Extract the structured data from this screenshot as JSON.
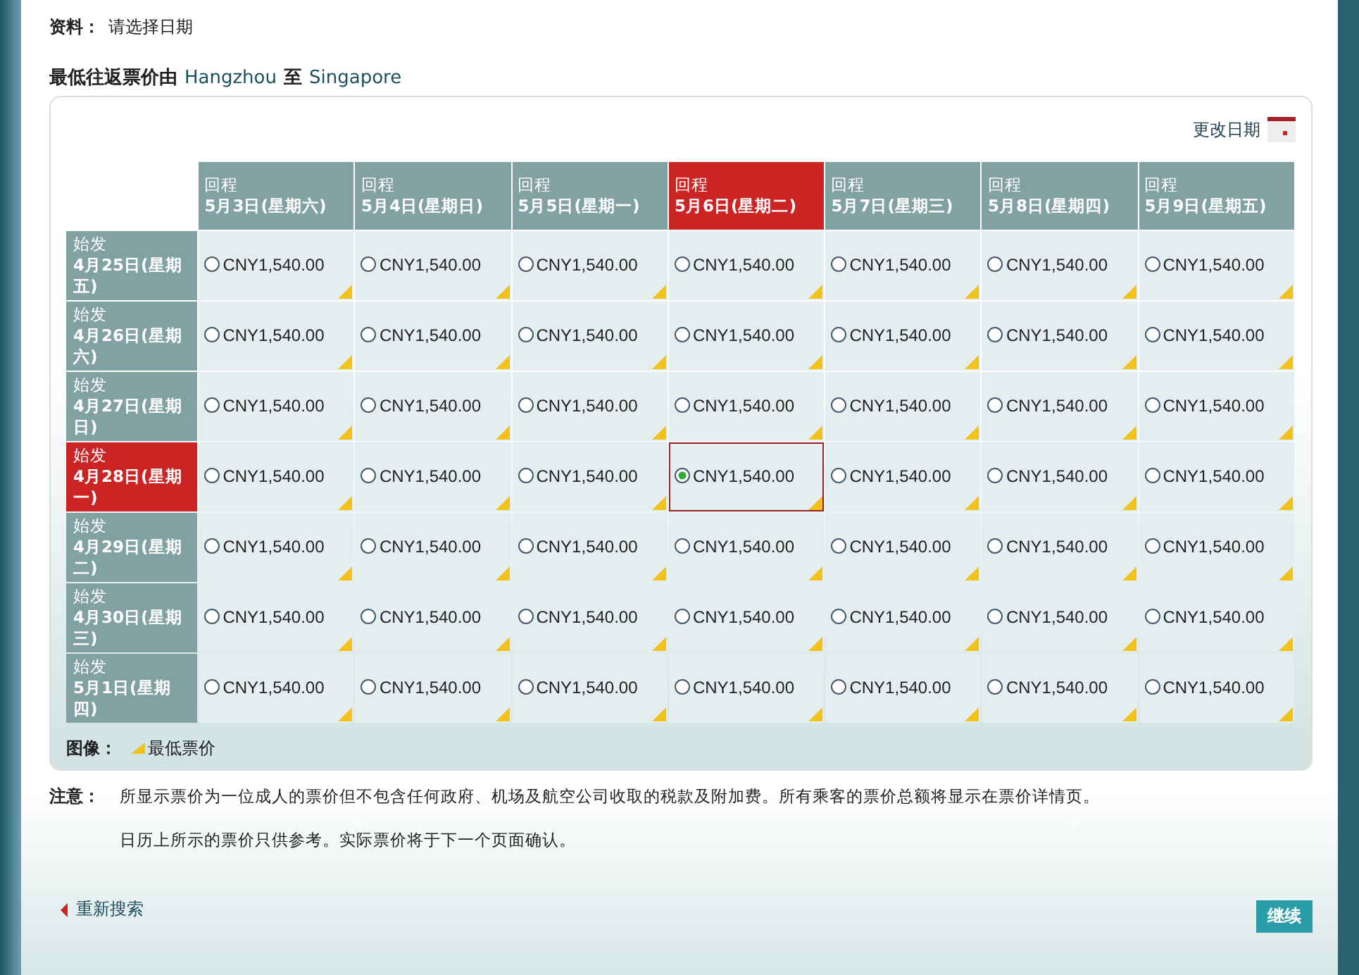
{
  "info": {
    "label": "资料：",
    "text": "请选择日期"
  },
  "heading": {
    "text": "最低往返票价由",
    "origin": "Hangzhou",
    "joiner": "至",
    "destination": "Singapore"
  },
  "change_date": {
    "label": "更改日期"
  },
  "columns": [
    {
      "kind_label": "回程",
      "date": "5月3日(星期六)",
      "selected": false
    },
    {
      "kind_label": "回程",
      "date": "5月4日(星期日)",
      "selected": false
    },
    {
      "kind_label": "回程",
      "date": "5月5日(星期一)",
      "selected": false
    },
    {
      "kind_label": "回程",
      "date": "5月6日(星期二)",
      "selected": true
    },
    {
      "kind_label": "回程",
      "date": "5月7日(星期三)",
      "selected": false
    },
    {
      "kind_label": "回程",
      "date": "5月8日(星期四)",
      "selected": false
    },
    {
      "kind_label": "回程",
      "date": "5月9日(星期五)",
      "selected": false
    }
  ],
  "rows": [
    {
      "kind_label": "始发",
      "date": "4月25日(星期五)",
      "selected": false,
      "cells": [
        {
          "price": "CNY1,540.00",
          "selected": false,
          "lowest": true
        },
        {
          "price": "CNY1,540.00",
          "selected": false,
          "lowest": true
        },
        {
          "price": "CNY1,540.00",
          "selected": false,
          "lowest": true
        },
        {
          "price": "CNY1,540.00",
          "selected": false,
          "lowest": true
        },
        {
          "price": "CNY1,540.00",
          "selected": false,
          "lowest": true
        },
        {
          "price": "CNY1,540.00",
          "selected": false,
          "lowest": true
        },
        {
          "price": "CNY1,540.00",
          "selected": false,
          "lowest": true
        }
      ]
    },
    {
      "kind_label": "始发",
      "date": "4月26日(星期六)",
      "selected": false,
      "cells": [
        {
          "price": "CNY1,540.00",
          "selected": false,
          "lowest": true
        },
        {
          "price": "CNY1,540.00",
          "selected": false,
          "lowest": true
        },
        {
          "price": "CNY1,540.00",
          "selected": false,
          "lowest": true
        },
        {
          "price": "CNY1,540.00",
          "selected": false,
          "lowest": true
        },
        {
          "price": "CNY1,540.00",
          "selected": false,
          "lowest": true
        },
        {
          "price": "CNY1,540.00",
          "selected": false,
          "lowest": true
        },
        {
          "price": "CNY1,540.00",
          "selected": false,
          "lowest": true
        }
      ]
    },
    {
      "kind_label": "始发",
      "date": "4月27日(星期日)",
      "selected": false,
      "cells": [
        {
          "price": "CNY1,540.00",
          "selected": false,
          "lowest": true
        },
        {
          "price": "CNY1,540.00",
          "selected": false,
          "lowest": true
        },
        {
          "price": "CNY1,540.00",
          "selected": false,
          "lowest": true
        },
        {
          "price": "CNY1,540.00",
          "selected": false,
          "lowest": true
        },
        {
          "price": "CNY1,540.00",
          "selected": false,
          "lowest": true
        },
        {
          "price": "CNY1,540.00",
          "selected": false,
          "lowest": true
        },
        {
          "price": "CNY1,540.00",
          "selected": false,
          "lowest": true
        }
      ]
    },
    {
      "kind_label": "始发",
      "date": "4月28日(星期一)",
      "selected": true,
      "cells": [
        {
          "price": "CNY1,540.00",
          "selected": false,
          "lowest": true
        },
        {
          "price": "CNY1,540.00",
          "selected": false,
          "lowest": true
        },
        {
          "price": "CNY1,540.00",
          "selected": false,
          "lowest": true
        },
        {
          "price": "CNY1,540.00",
          "selected": true,
          "lowest": true
        },
        {
          "price": "CNY1,540.00",
          "selected": false,
          "lowest": true
        },
        {
          "price": "CNY1,540.00",
          "selected": false,
          "lowest": true
        },
        {
          "price": "CNY1,540.00",
          "selected": false,
          "lowest": true
        }
      ]
    },
    {
      "kind_label": "始发",
      "date": "4月29日(星期二)",
      "selected": false,
      "cells": [
        {
          "price": "CNY1,540.00",
          "selected": false,
          "lowest": true
        },
        {
          "price": "CNY1,540.00",
          "selected": false,
          "lowest": true
        },
        {
          "price": "CNY1,540.00",
          "selected": false,
          "lowest": true
        },
        {
          "price": "CNY1,540.00",
          "selected": false,
          "lowest": true
        },
        {
          "price": "CNY1,540.00",
          "selected": false,
          "lowest": true
        },
        {
          "price": "CNY1,540.00",
          "selected": false,
          "lowest": true
        },
        {
          "price": "CNY1,540.00",
          "selected": false,
          "lowest": true
        }
      ]
    },
    {
      "kind_label": "始发",
      "date": "4月30日(星期三)",
      "selected": false,
      "cells": [
        {
          "price": "CNY1,540.00",
          "selected": false,
          "lowest": true
        },
        {
          "price": "CNY1,540.00",
          "selected": false,
          "lowest": true
        },
        {
          "price": "CNY1,540.00",
          "selected": false,
          "lowest": true
        },
        {
          "price": "CNY1,540.00",
          "selected": false,
          "lowest": true
        },
        {
          "price": "CNY1,540.00",
          "selected": false,
          "lowest": true
        },
        {
          "price": "CNY1,540.00",
          "selected": false,
          "lowest": true
        },
        {
          "price": "CNY1,540.00",
          "selected": false,
          "lowest": true
        }
      ]
    },
    {
      "kind_label": "始发",
      "date": "5月1日(星期四)",
      "selected": false,
      "cells": [
        {
          "price": "CNY1,540.00",
          "selected": false,
          "lowest": true
        },
        {
          "price": "CNY1,540.00",
          "selected": false,
          "lowest": true
        },
        {
          "price": "CNY1,540.00",
          "selected": false,
          "lowest": true
        },
        {
          "price": "CNY1,540.00",
          "selected": false,
          "lowest": true
        },
        {
          "price": "CNY1,540.00",
          "selected": false,
          "lowest": true
        },
        {
          "price": "CNY1,540.00",
          "selected": false,
          "lowest": true
        },
        {
          "price": "CNY1,540.00",
          "selected": false,
          "lowest": true
        }
      ]
    }
  ],
  "legend": {
    "label": "图像：",
    "text": "最低票价"
  },
  "notes": {
    "label": "注意：",
    "lines": [
      "所显示票价为一位成人的票价但不包含任何政府、机场及航空公司收取的税款及附加费。所有乘客的票价总额将显示在票价详情页。",
      "日历上所示的票价只供参考。实际票价将于下一个页面确认。"
    ]
  },
  "back_link": {
    "label": "重新搜索"
  },
  "continue_button": {
    "label": "继续"
  }
}
